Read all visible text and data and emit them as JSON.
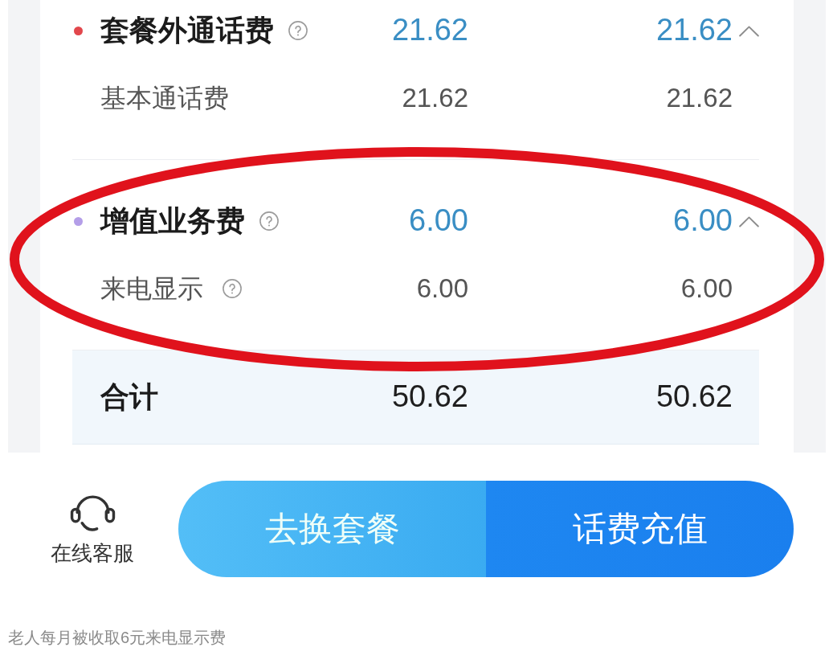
{
  "fee_groups": [
    {
      "label": "套餐外通话费",
      "color": "#e2474c",
      "help": true,
      "values": [
        "21.62",
        "21.62"
      ],
      "expanded": true,
      "circled": false,
      "items": [
        {
          "label": "基本通话费",
          "help": false,
          "values": [
            "21.62",
            "21.62"
          ]
        }
      ]
    },
    {
      "label": "增值业务费",
      "color": "#b49ee8",
      "help": true,
      "values": [
        "6.00",
        "6.00"
      ],
      "expanded": true,
      "circled": true,
      "items": [
        {
          "label": "来电显示",
          "help": true,
          "values": [
            "6.00",
            "6.00"
          ]
        }
      ]
    }
  ],
  "summary": {
    "label": "合计",
    "values": [
      "50.62",
      "50.62"
    ]
  },
  "bottom_bar": {
    "service": {
      "label": "在线客服"
    },
    "buttons": [
      {
        "label": "去换套餐",
        "kind": "secondary"
      },
      {
        "label": "话费充值",
        "kind": "primary"
      }
    ]
  },
  "caption": "老人每月被收取6元来电显示费"
}
